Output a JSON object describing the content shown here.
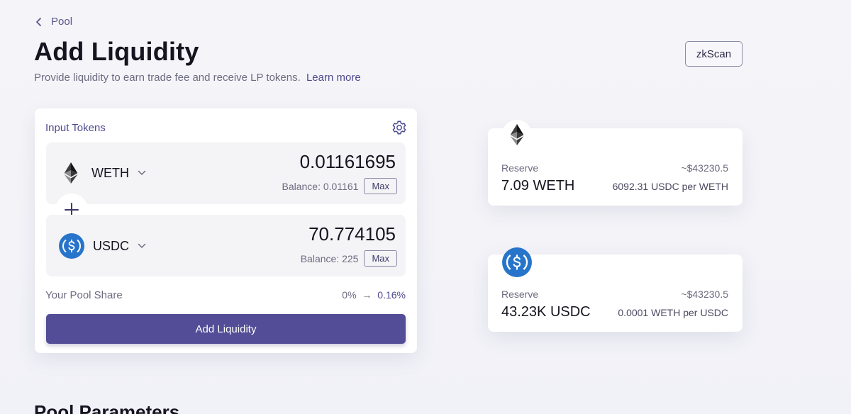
{
  "nav": {
    "back_label": "Pool"
  },
  "header": {
    "title": "Add Liquidity",
    "subtitle": "Provide liquidity to earn trade fee and receive LP tokens.",
    "learn_more": "Learn more",
    "explorer_button": "zkScan"
  },
  "input_card": {
    "label": "Input Tokens",
    "tokens": [
      {
        "symbol": "WETH",
        "icon": "eth-icon",
        "amount": "0.01161695",
        "balance": "Balance: 0.01161",
        "max_label": "Max"
      },
      {
        "symbol": "USDC",
        "icon": "usdc-icon",
        "amount": "70.774105",
        "balance": "Balance: 225",
        "max_label": "Max"
      }
    ],
    "pool_share": {
      "label": "Your Pool Share",
      "from": "0%",
      "arrow": "→",
      "to": "0.16%"
    },
    "submit_label": "Add Liquidity"
  },
  "reserves": [
    {
      "icon": "eth-icon",
      "label": "Reserve",
      "usd": "~$43230.5",
      "amount": "7.09 WETH",
      "rate": "6092.31 USDC per WETH"
    },
    {
      "icon": "usdc-icon",
      "label": "Reserve",
      "usd": "~$43230.5",
      "amount": "43.23K USDC",
      "rate": "0.0001 WETH per USDC"
    }
  ],
  "section": {
    "title": "Pool Parameters"
  },
  "colors": {
    "accent": "#524d96",
    "link": "#4f4a8f",
    "usdc_blue": "#2775ca"
  }
}
